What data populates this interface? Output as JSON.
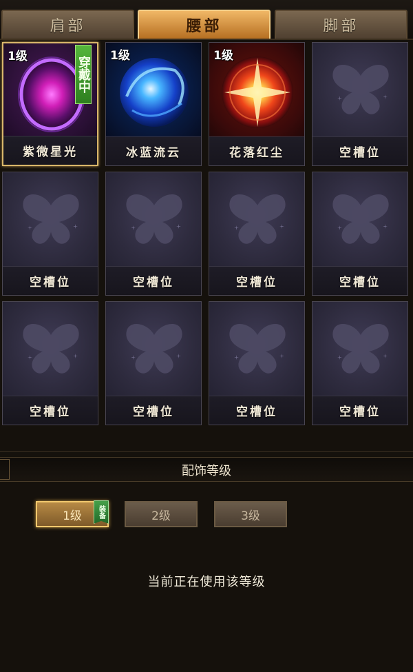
{
  "tabs": [
    {
      "label": "肩部",
      "active": false
    },
    {
      "label": "腰部",
      "active": true
    },
    {
      "label": "脚部",
      "active": false
    }
  ],
  "slots": [
    {
      "name": "紫微星光",
      "level": "1级",
      "worn_label": "穿戴中",
      "icon": "purple-ring-orb-icon"
    },
    {
      "name": "冰蓝流云",
      "level": "1级",
      "icon": "blue-swirl-orb-icon"
    },
    {
      "name": "花落红尘",
      "level": "1级",
      "icon": "red-starburst-orb-icon"
    },
    {
      "name": "空槽位",
      "icon": "butterfly-placeholder-icon"
    },
    {
      "name": "空槽位",
      "icon": "butterfly-placeholder-icon"
    },
    {
      "name": "空槽位",
      "icon": "butterfly-placeholder-icon"
    },
    {
      "name": "空槽位",
      "icon": "butterfly-placeholder-icon"
    },
    {
      "name": "空槽位",
      "icon": "butterfly-placeholder-icon"
    },
    {
      "name": "空槽位",
      "icon": "butterfly-placeholder-icon"
    },
    {
      "name": "空槽位",
      "icon": "butterfly-placeholder-icon"
    },
    {
      "name": "空槽位",
      "icon": "butterfly-placeholder-icon"
    },
    {
      "name": "空槽位",
      "icon": "butterfly-placeholder-icon"
    }
  ],
  "section": {
    "title": "配饰等级"
  },
  "levels": [
    {
      "label": "1级",
      "active": true,
      "badge": "装备"
    },
    {
      "label": "2级",
      "active": false
    },
    {
      "label": "3级",
      "active": false
    }
  ],
  "status_text": "当前正在使用该等级",
  "colors": {
    "accent": "#f0b766",
    "badge_green": "#3f9d2f",
    "slot_bg": "#221f2c"
  }
}
